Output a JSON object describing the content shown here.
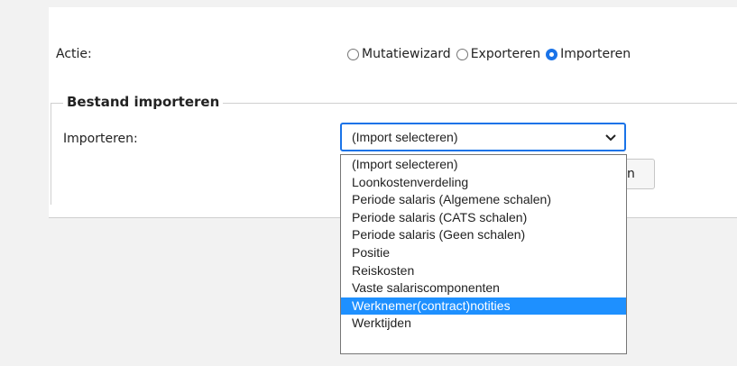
{
  "action": {
    "label": "Actie:",
    "options": [
      {
        "label": "Mutatiewizard",
        "checked": false
      },
      {
        "label": "Exporteren",
        "checked": false
      },
      {
        "label": "Importeren",
        "checked": true
      }
    ]
  },
  "import_section": {
    "legend": "Bestand importeren",
    "field_label": "Importeren:",
    "selected_value": "(Import selecteren)",
    "partial_button_text": "n",
    "options": [
      {
        "label": "(Import selecteren)",
        "highlighted": false
      },
      {
        "label": "Loonkostenverdeling",
        "highlighted": false
      },
      {
        "label": "Periode salaris (Algemene schalen)",
        "highlighted": false
      },
      {
        "label": "Periode salaris (CATS schalen)",
        "highlighted": false
      },
      {
        "label": "Periode salaris (Geen schalen)",
        "highlighted": false
      },
      {
        "label": "Positie",
        "highlighted": false
      },
      {
        "label": "Reiskosten",
        "highlighted": false
      },
      {
        "label": "Vaste salariscomponenten",
        "highlighted": false
      },
      {
        "label": "Werknemer(contract)notities",
        "highlighted": true
      },
      {
        "label": "Werktijden",
        "highlighted": false
      }
    ]
  },
  "colors": {
    "accent": "#1a73e8",
    "highlight": "#1e90ff"
  }
}
